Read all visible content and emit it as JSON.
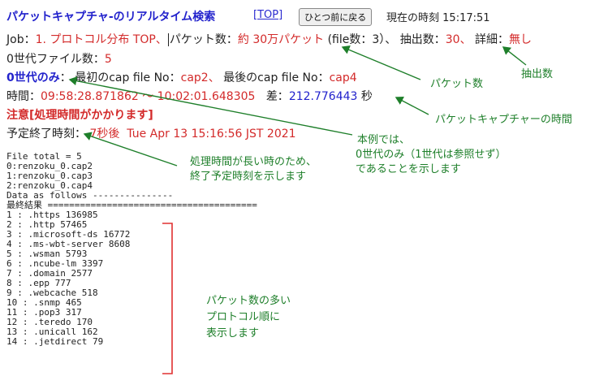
{
  "header": {
    "title": "パケットキャプチャ-のリアルタイム検索",
    "top_link": "[TOP]",
    "back_button": "ひとつ前に戻る",
    "clock_label": "現在の時刻",
    "clock_value": "15:17:51"
  },
  "job_line": {
    "job_label": "Job：",
    "job_value": "1. プロトコル分布 TOP、",
    "packets_label": "パケット数：",
    "packets_value": "約 30万パケット",
    "file_count": "(file数：3）、",
    "extract_label": "抽出数：",
    "extract_value": "30、",
    "detail_label": "詳細：",
    "detail_value": "無し"
  },
  "gen_files": {
    "label": "0世代ファイル数：",
    "value": "5"
  },
  "gen_line": {
    "gen_only": "0世代のみ",
    "sep": "：",
    "first_label": "最初のcap file No：",
    "first_value": "cap2、",
    "last_label": "最後のcap file No：",
    "last_value": "cap4"
  },
  "time_line": {
    "label": "時間：",
    "range": "09:58:28.871862 ～ 10:02:01.648305",
    "diff_label": "差：",
    "diff_value": "212.776443",
    "diff_unit": "秒"
  },
  "notice": "注意[処理時間がかかります]",
  "eta": {
    "label": "予定終了時刻：",
    "remain": "7秒後",
    "datetime": "Tue Apr 13 15:16:56 JST 2021"
  },
  "output": {
    "lines": [
      "File total = 5",
      "0:renzoku_0.cap2",
      "1:renzoku_0.cap3",
      "2:renzoku_0.cap4",
      "Data as follows ---------------",
      "最終結果 =======================================",
      "1 : .https 136985",
      "2 : .http 57465",
      "3 : .microsoft-ds 16772",
      "4 : .ms-wbt-server 8608",
      "5 : .wsman 5793",
      "6 : .ncube-lm 3397",
      "7 : .domain 2577",
      "8 : .epp 777",
      "9 : .webcache 518",
      "10 : .snmp 465",
      "11 : .pop3 317",
      "12 : .teredo 170",
      "13 : .unicall 162",
      "14 : .jetdirect 79"
    ]
  },
  "annotations": {
    "packets": "パケット数",
    "extract": "抽出数",
    "capture_time": "パケットキャプチャーの時間",
    "example_l1": "本例では、",
    "example_l2": "0世代のみ（1世代は参照せず）",
    "example_l3": "であることを示します",
    "eta_l1": "処理時間が長い時のため、",
    "eta_l2": "終了予定時刻を示します",
    "order_l1": "パケット数の多い",
    "order_l2": "プロトコル順に",
    "order_l3": "表示します"
  },
  "colors": {
    "title_blue": "#2222cc",
    "value_red": "#d32a2a",
    "annotation_green": "#1e7f2a",
    "bracket_red": "#e03030"
  }
}
